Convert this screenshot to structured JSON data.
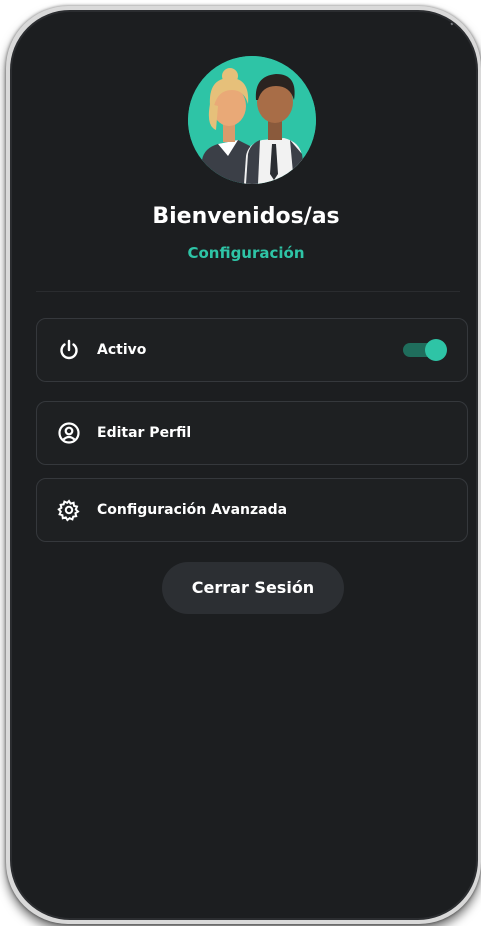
{
  "header": {
    "close_glyph": "✕",
    "title": "Bienvenidos/as",
    "subtitle": "Configuración"
  },
  "avatar": {
    "icon": "people-avatar-icon",
    "background_color": "#2ec4a6"
  },
  "menu": {
    "items": [
      {
        "icon": "power-icon",
        "label": "Activo",
        "toggle": {
          "on": true
        }
      },
      {
        "icon": "user-circle-icon",
        "label": "Editar Perfil"
      },
      {
        "icon": "gear-icon",
        "label": "Configuración Avanzada"
      }
    ]
  },
  "actions": {
    "logout_label": "Cerrar Sesión"
  },
  "colors": {
    "accent": "#2ec4a6",
    "background": "#1c1e20",
    "card_border": "#35383c",
    "button_bg": "#2c2f33"
  }
}
